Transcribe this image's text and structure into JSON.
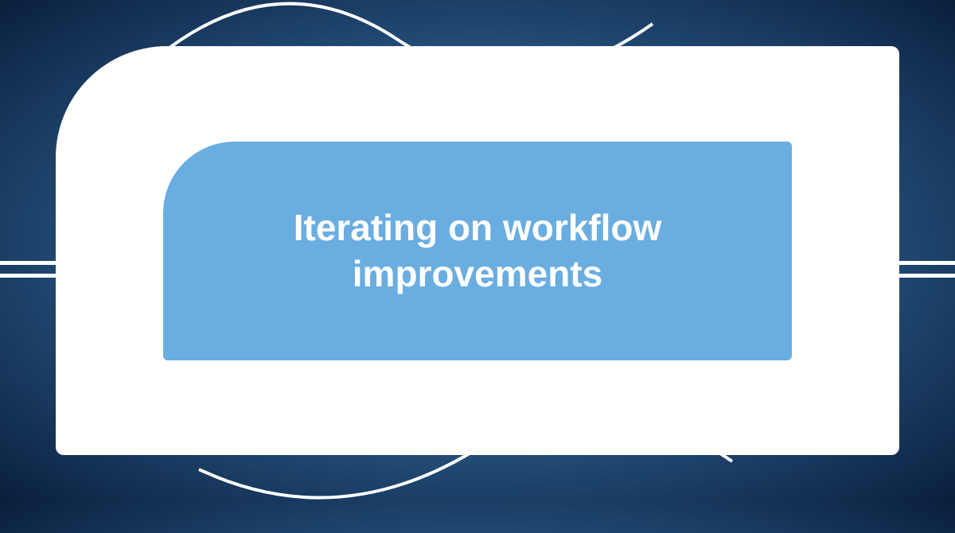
{
  "title": "Iterating on workflow improvements"
}
